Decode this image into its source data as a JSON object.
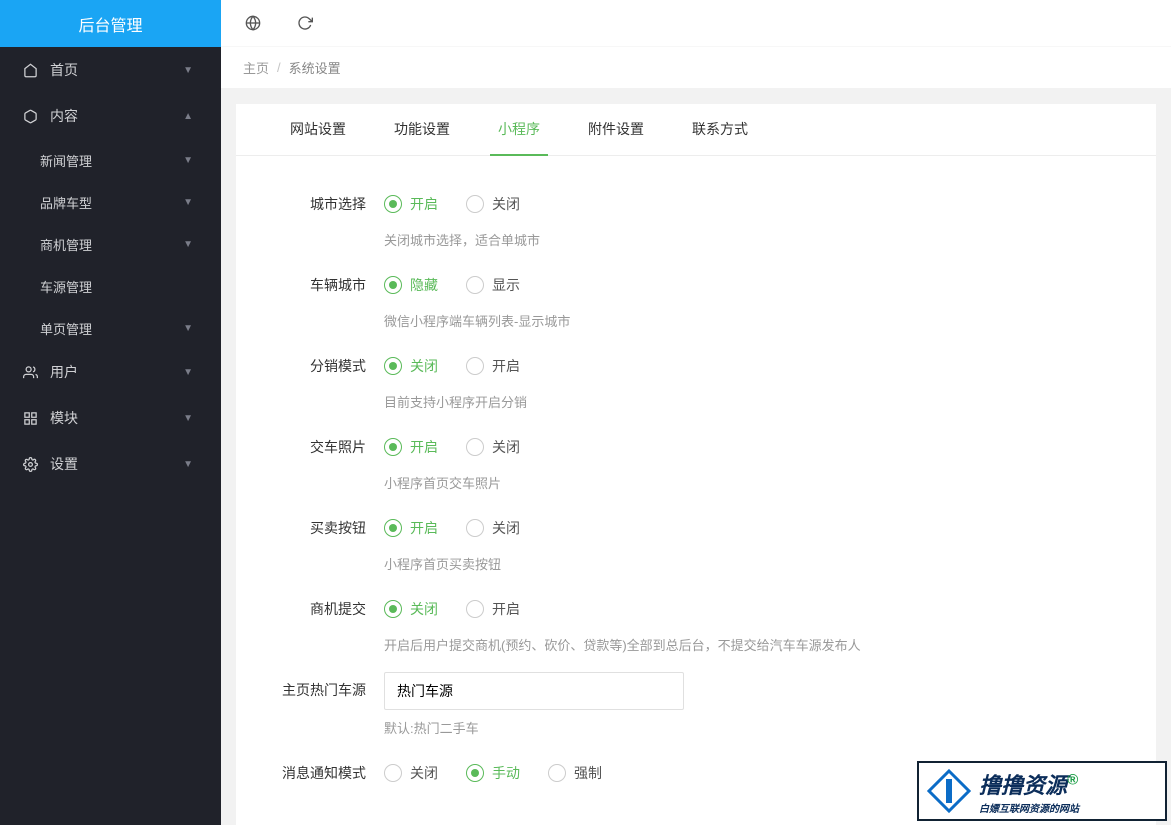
{
  "brand": {
    "title": "后台管理"
  },
  "sidebar": {
    "items": [
      {
        "label": "首页",
        "icon": "home",
        "expanded": false
      },
      {
        "label": "内容",
        "icon": "cube",
        "expanded": true,
        "children": [
          {
            "label": "新闻管理",
            "chev": true
          },
          {
            "label": "品牌车型",
            "chev": true
          },
          {
            "label": "商机管理",
            "chev": true
          },
          {
            "label": "车源管理",
            "chev": false
          },
          {
            "label": "单页管理",
            "chev": true
          }
        ]
      },
      {
        "label": "用户",
        "icon": "users",
        "expanded": false
      },
      {
        "label": "模块",
        "icon": "grid",
        "expanded": false
      },
      {
        "label": "设置",
        "icon": "gear",
        "expanded": false
      }
    ]
  },
  "breadcrumb": {
    "home": "主页",
    "sep": "/",
    "current": "系统设置"
  },
  "tabs": [
    {
      "label": "网站设置"
    },
    {
      "label": "功能设置"
    },
    {
      "label": "小程序",
      "active": true
    },
    {
      "label": "附件设置"
    },
    {
      "label": "联系方式"
    }
  ],
  "form": {
    "cityChoice": {
      "label": "城市选择",
      "opt1": "开启",
      "opt2": "关闭",
      "help": "关闭城市选择，适合单城市",
      "checked": 0
    },
    "vehicleCity": {
      "label": "车辆城市",
      "opt1": "隐藏",
      "opt2": "显示",
      "help": "微信小程序端车辆列表-显示城市",
      "checked": 0
    },
    "distMode": {
      "label": "分销模式",
      "opt1": "关闭",
      "opt2": "开启",
      "help": "目前支持小程序开启分销",
      "checked": 0
    },
    "deliveryPhoto": {
      "label": "交车照片",
      "opt1": "开启",
      "opt2": "关闭",
      "help": "小程序首页交车照片",
      "checked": 0
    },
    "buySellBtn": {
      "label": "买卖按钮",
      "opt1": "开启",
      "opt2": "关闭",
      "help": "小程序首页买卖按钮",
      "checked": 0
    },
    "bizSubmit": {
      "label": "商机提交",
      "opt1": "关闭",
      "opt2": "开启",
      "help": "开启后用户提交商机(预约、砍价、贷款等)全部到总后台，不提交给汽车车源发布人",
      "checked": 0
    },
    "hotCars": {
      "label": "主页热门车源",
      "value": "热门车源",
      "help": "默认:热门二手车"
    },
    "notifyMode": {
      "label": "消息通知模式",
      "opt1": "关闭",
      "opt2": "手动",
      "opt3": "强制",
      "checked": 1
    }
  },
  "watermark": {
    "big": "撸撸资源",
    "reg": "®",
    "small": "白嫖互联网资源的网站"
  }
}
